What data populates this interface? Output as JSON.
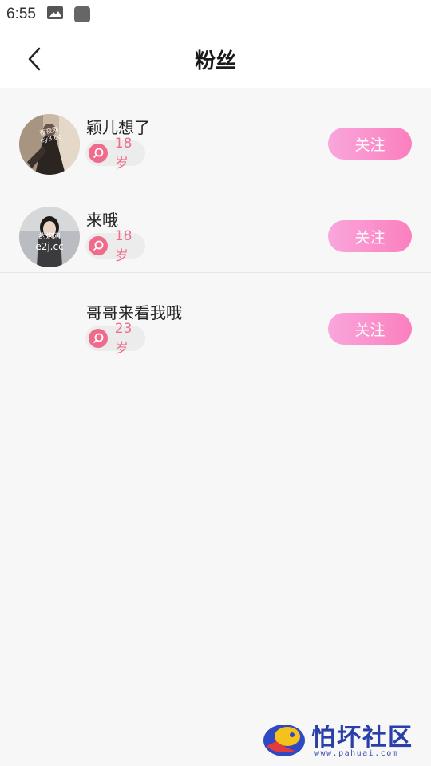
{
  "status_bar": {
    "time": "6:55",
    "icons": [
      "image-icon",
      "app-icon"
    ]
  },
  "header": {
    "title": "粉丝",
    "back_icon": "chevron-left-icon"
  },
  "fans": [
    {
      "name": "颖儿想了",
      "age": "18岁",
      "follow_label": "关注",
      "avatar": "photo",
      "avatar_text_lines": [
        "夜夜网",
        "ey3.cc"
      ]
    },
    {
      "name": "来哦",
      "age": "18岁",
      "follow_label": "关注",
      "avatar": "photo",
      "avatar_text_lines": [
        "约炮网",
        "e2j.cc"
      ]
    },
    {
      "name": "哥哥来看我哦",
      "age": "23岁",
      "follow_label": "关注",
      "avatar": "none"
    }
  ],
  "watermark": {
    "title": "怕坏社区",
    "url": "www.pahuai.com"
  },
  "colors": {
    "follow_gradient_start": "#f9a6dc",
    "follow_gradient_end": "#fb7fbe",
    "age_text": "#ee6f8b",
    "gender_icon_bg": "#f06b8b",
    "page_bg": "#f7f7f7"
  }
}
